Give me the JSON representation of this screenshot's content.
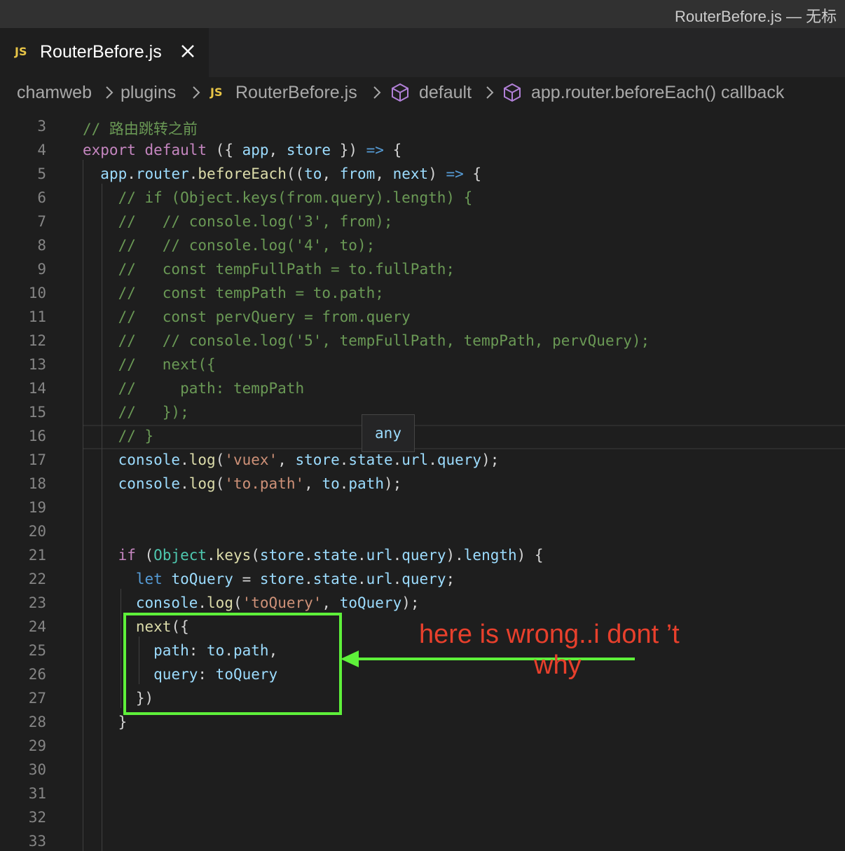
{
  "window": {
    "title": "RouterBefore.js — 无标"
  },
  "tab": {
    "icon": "JS",
    "label": "RouterBefore.js"
  },
  "breadcrumb": {
    "items": [
      "chamweb",
      "plugins",
      "RouterBefore.js",
      "default",
      "app.router.beforeEach() callback"
    ],
    "file_icon": "JS"
  },
  "hover": {
    "text": "any"
  },
  "annotation": {
    "line1": "here is wrong..i  dont ’t",
    "line2": "why"
  },
  "lines": [
    {
      "n": "3"
    },
    {
      "n": "4"
    },
    {
      "n": "5"
    },
    {
      "n": "6"
    },
    {
      "n": "7"
    },
    {
      "n": "8"
    },
    {
      "n": "9"
    },
    {
      "n": "10"
    },
    {
      "n": "11"
    },
    {
      "n": "12"
    },
    {
      "n": "13"
    },
    {
      "n": "14"
    },
    {
      "n": "15"
    },
    {
      "n": "16"
    },
    {
      "n": "17"
    },
    {
      "n": "18"
    },
    {
      "n": "19"
    },
    {
      "n": "20"
    },
    {
      "n": "21"
    },
    {
      "n": "22"
    },
    {
      "n": "23"
    },
    {
      "n": "24"
    },
    {
      "n": "25"
    },
    {
      "n": "26"
    },
    {
      "n": "27"
    },
    {
      "n": "28"
    },
    {
      "n": "29"
    },
    {
      "n": "30"
    },
    {
      "n": "31"
    },
    {
      "n": "32"
    },
    {
      "n": "33"
    }
  ],
  "code": [
    [
      [
        "cm",
        "// 路由跳转之前"
      ]
    ],
    [
      [
        "kw",
        "export"
      ],
      [
        "pl",
        " "
      ],
      [
        "kw",
        "default"
      ],
      [
        "pl",
        " ({ "
      ],
      [
        "var",
        "app"
      ],
      [
        "pl",
        ", "
      ],
      [
        "var",
        "store"
      ],
      [
        "pl",
        " }) "
      ],
      [
        "kb",
        "=>"
      ],
      [
        "pl",
        " {"
      ]
    ],
    [
      [
        "pl",
        "  "
      ],
      [
        "var",
        "app"
      ],
      [
        "pl",
        "."
      ],
      [
        "var",
        "router"
      ],
      [
        "pl",
        "."
      ],
      [
        "fn",
        "beforeEach"
      ],
      [
        "pl",
        "(("
      ],
      [
        "var",
        "to"
      ],
      [
        "pl",
        ", "
      ],
      [
        "var",
        "from"
      ],
      [
        "pl",
        ", "
      ],
      [
        "var",
        "next"
      ],
      [
        "pl",
        ") "
      ],
      [
        "kb",
        "=>"
      ],
      [
        "pl",
        " {"
      ]
    ],
    [
      [
        "pl",
        "    "
      ],
      [
        "cm",
        "// if (Object.keys(from.query).length) {"
      ]
    ],
    [
      [
        "pl",
        "    "
      ],
      [
        "cm",
        "//   // console.log('3', from);"
      ]
    ],
    [
      [
        "pl",
        "    "
      ],
      [
        "cm",
        "//   // console.log('4', to);"
      ]
    ],
    [
      [
        "pl",
        "    "
      ],
      [
        "cm",
        "//   const tempFullPath = to.fullPath;"
      ]
    ],
    [
      [
        "pl",
        "    "
      ],
      [
        "cm",
        "//   const tempPath = to.path;"
      ]
    ],
    [
      [
        "pl",
        "    "
      ],
      [
        "cm",
        "//   const pervQuery = from.query"
      ]
    ],
    [
      [
        "pl",
        "    "
      ],
      [
        "cm",
        "//   // console.log('5', tempFullPath, tempPath, pervQuery);"
      ]
    ],
    [
      [
        "pl",
        "    "
      ],
      [
        "cm",
        "//   next({"
      ]
    ],
    [
      [
        "pl",
        "    "
      ],
      [
        "cm",
        "//     path: tempPath"
      ]
    ],
    [
      [
        "pl",
        "    "
      ],
      [
        "cm",
        "//   });"
      ]
    ],
    [
      [
        "pl",
        "    "
      ],
      [
        "cm",
        "// }"
      ]
    ],
    [
      [
        "pl",
        "    "
      ],
      [
        "var",
        "console"
      ],
      [
        "pl",
        "."
      ],
      [
        "fn",
        "log"
      ],
      [
        "pl",
        "("
      ],
      [
        "str",
        "'vuex'"
      ],
      [
        "pl",
        ", "
      ],
      [
        "var",
        "store"
      ],
      [
        "pl",
        "."
      ],
      [
        "var",
        "state"
      ],
      [
        "pl",
        "."
      ],
      [
        "var",
        "url"
      ],
      [
        "pl",
        "."
      ],
      [
        "var",
        "query"
      ],
      [
        "pl",
        ");"
      ]
    ],
    [
      [
        "pl",
        "    "
      ],
      [
        "var",
        "console"
      ],
      [
        "pl",
        "."
      ],
      [
        "fn",
        "log"
      ],
      [
        "pl",
        "("
      ],
      [
        "str",
        "'to.path'"
      ],
      [
        "pl",
        ", "
      ],
      [
        "var",
        "to"
      ],
      [
        "pl",
        "."
      ],
      [
        "var",
        "path"
      ],
      [
        "pl",
        ");"
      ]
    ],
    [],
    [],
    [
      [
        "pl",
        "    "
      ],
      [
        "kw",
        "if"
      ],
      [
        "pl",
        " ("
      ],
      [
        "cls",
        "Object"
      ],
      [
        "pl",
        "."
      ],
      [
        "fn",
        "keys"
      ],
      [
        "pl",
        "("
      ],
      [
        "var",
        "store"
      ],
      [
        "pl",
        "."
      ],
      [
        "var",
        "state"
      ],
      [
        "pl",
        "."
      ],
      [
        "var",
        "url"
      ],
      [
        "pl",
        "."
      ],
      [
        "var",
        "query"
      ],
      [
        "pl",
        ")."
      ],
      [
        "var",
        "length"
      ],
      [
        "pl",
        ") {"
      ]
    ],
    [
      [
        "pl",
        "      "
      ],
      [
        "kb",
        "let"
      ],
      [
        "pl",
        " "
      ],
      [
        "var",
        "toQuery"
      ],
      [
        "pl",
        " = "
      ],
      [
        "var",
        "store"
      ],
      [
        "pl",
        "."
      ],
      [
        "var",
        "state"
      ],
      [
        "pl",
        "."
      ],
      [
        "var",
        "url"
      ],
      [
        "pl",
        "."
      ],
      [
        "var",
        "query"
      ],
      [
        "pl",
        ";"
      ]
    ],
    [
      [
        "pl",
        "      "
      ],
      [
        "var",
        "console"
      ],
      [
        "pl",
        "."
      ],
      [
        "fn",
        "log"
      ],
      [
        "pl",
        "("
      ],
      [
        "str",
        "'toQuery'"
      ],
      [
        "pl",
        ", "
      ],
      [
        "var",
        "toQuery"
      ],
      [
        "pl",
        ");"
      ]
    ],
    [
      [
        "pl",
        "      "
      ],
      [
        "fn",
        "next"
      ],
      [
        "pl",
        "({"
      ]
    ],
    [
      [
        "pl",
        "        "
      ],
      [
        "var",
        "path"
      ],
      [
        "pl",
        ": "
      ],
      [
        "var",
        "to"
      ],
      [
        "pl",
        "."
      ],
      [
        "var",
        "path"
      ],
      [
        "pl",
        ","
      ]
    ],
    [
      [
        "pl",
        "        "
      ],
      [
        "var",
        "query"
      ],
      [
        "pl",
        ": "
      ],
      [
        "var",
        "toQuery"
      ]
    ],
    [
      [
        "pl",
        "      })"
      ]
    ],
    [
      [
        "pl",
        "    }"
      ]
    ],
    [],
    [],
    [],
    [],
    []
  ]
}
